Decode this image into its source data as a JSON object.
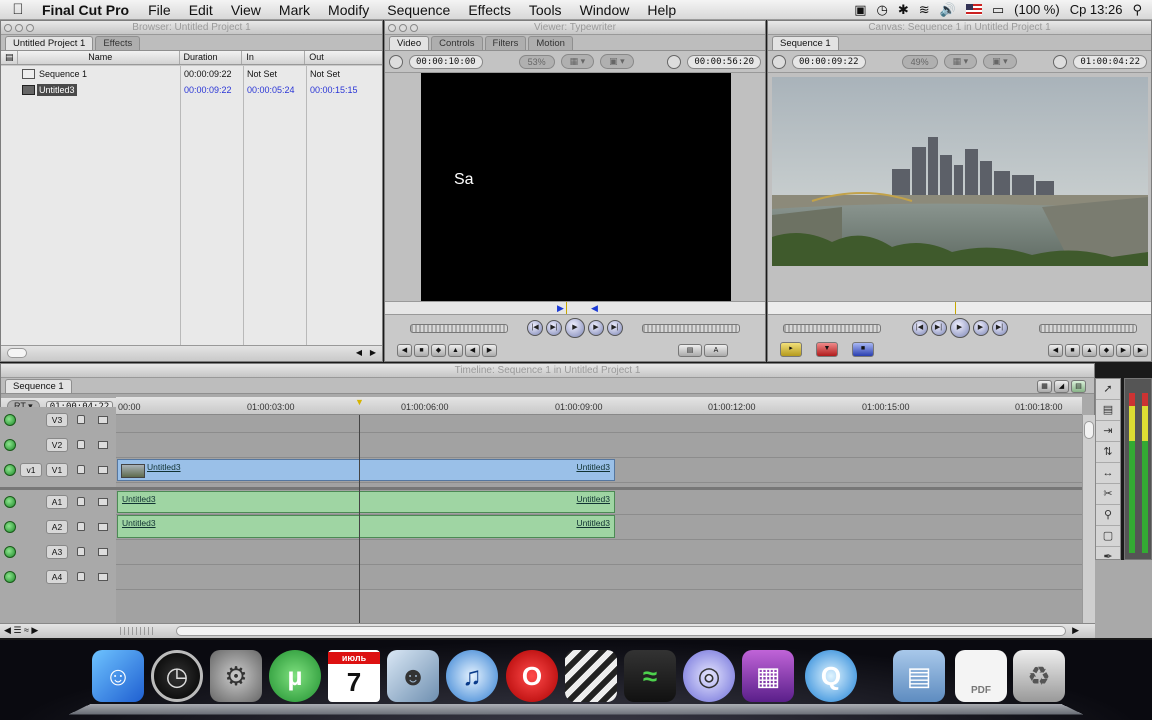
{
  "menubar": {
    "app": "Final Cut Pro",
    "items": [
      "File",
      "Edit",
      "View",
      "Mark",
      "Modify",
      "Sequence",
      "Effects",
      "Tools",
      "Window",
      "Help"
    ],
    "battery": "(100 %)",
    "clock": "Ср 13:26"
  },
  "browser": {
    "title": "Browser: Untitled Project 1",
    "tabs": [
      "Untitled Project 1",
      "Effects"
    ],
    "columns": [
      "Name",
      "Duration",
      "In",
      "Out"
    ],
    "rows": [
      {
        "name": "Sequence 1",
        "duration": "00:00:09:22",
        "in": "Not Set",
        "out": "Not Set"
      },
      {
        "name": "Untitled3",
        "duration": "00:00:09:22",
        "in": "00:00:05:24",
        "out": "00:00:15:15"
      }
    ]
  },
  "viewer": {
    "title": "Viewer: Typewriter",
    "tabs": [
      "Video",
      "Controls",
      "Filters",
      "Motion"
    ],
    "duration_tc": "00:00:10:00",
    "zoom": "53%",
    "current_tc": "00:00:56:20",
    "frame_text": "Sa"
  },
  "canvas": {
    "title": "Canvas: Sequence 1 in Untitled Project 1",
    "tabs": [
      "Sequence 1"
    ],
    "duration_tc": "00:00:09:22",
    "zoom": "49%",
    "current_tc": "01:00:04:22"
  },
  "timeline": {
    "title": "Timeline: Sequence 1 in Untitled Project 1",
    "tab": "Sequence 1",
    "rt": "RT",
    "current_tc": "01:00:04:22",
    "ruler": [
      "00:00",
      "01:00:03:00",
      "01:00:06:00",
      "01:00:09:00",
      "01:00:12:00",
      "01:00:15:00",
      "01:00:18:00"
    ],
    "tracks": [
      {
        "name": "V3",
        "src": ""
      },
      {
        "name": "V2",
        "src": ""
      },
      {
        "name": "V1",
        "src": "v1"
      },
      {
        "name": "A1",
        "src": ""
      },
      {
        "name": "A2",
        "src": ""
      },
      {
        "name": "A3",
        "src": ""
      },
      {
        "name": "A4",
        "src": ""
      }
    ],
    "clip_name": "Untitled3"
  },
  "dock": {
    "apps": [
      "Finder",
      "Dashboard",
      "System Preferences",
      "uTorrent",
      "iCal",
      "iPhoto",
      "iTunes",
      "Opera",
      "Final Cut Pro",
      "Soundtrack",
      "DVD Studio Pro",
      "Photo Booth",
      "QuickTime",
      "Folder",
      "PDF Document",
      "Trash"
    ],
    "ical_month": "июль",
    "ical_day": "7"
  }
}
